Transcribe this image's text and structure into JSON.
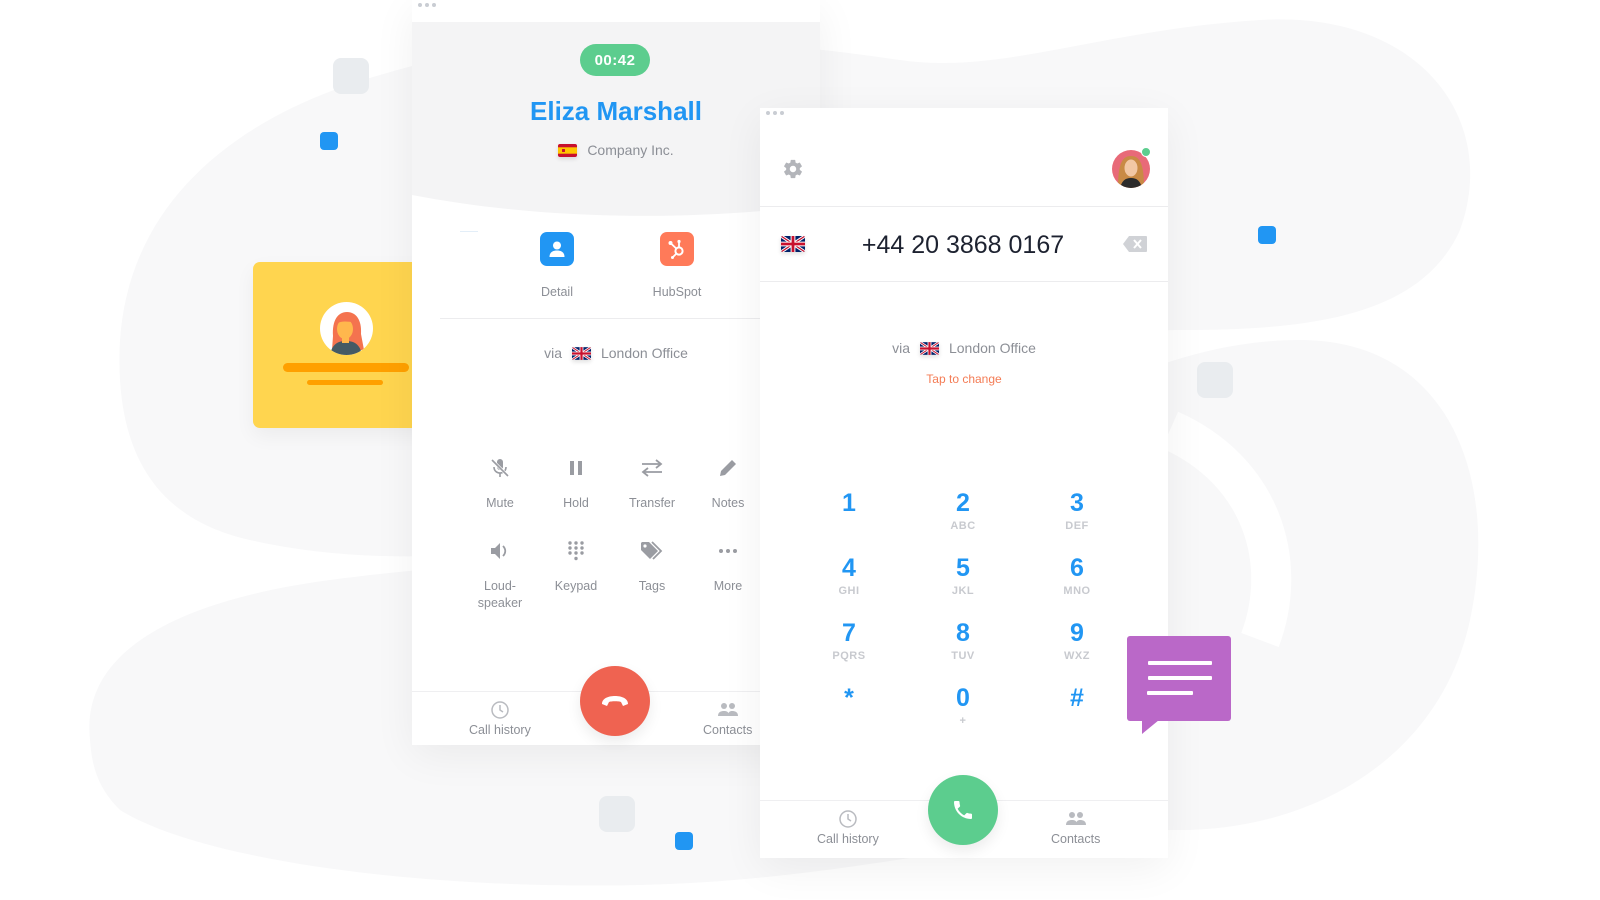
{
  "call_panel": {
    "timer": "00:42",
    "contact_name": "Eliza Marshall",
    "company": "Company Inc.",
    "company_flag": "spain-flag",
    "integrations": [
      {
        "label": "Detail",
        "icon": "contact-icon",
        "color": "#2196f3"
      },
      {
        "label": "HubSpot",
        "icon": "hubspot-icon",
        "color": "#ff7a59"
      }
    ],
    "via_prefix": "via",
    "via_line": "London Office",
    "via_flag": "uk-flag",
    "actions": [
      {
        "label": "Mute",
        "icon": "mic-off-icon"
      },
      {
        "label": "Hold",
        "icon": "pause-icon"
      },
      {
        "label": "Transfer",
        "icon": "transfer-icon"
      },
      {
        "label": "Notes",
        "icon": "pencil-icon"
      },
      {
        "label": "Loud-\nspeaker",
        "icon": "speaker-icon"
      },
      {
        "label": "Keypad",
        "icon": "keypad-icon"
      },
      {
        "label": "Tags",
        "icon": "tags-icon"
      },
      {
        "label": "More",
        "icon": "more-icon"
      }
    ],
    "nav": {
      "call_history": "Call history",
      "contacts": "Contacts"
    },
    "hangup_color": "#ef6351"
  },
  "dialer_panel": {
    "number": "+44 20 3868 0167",
    "number_flag": "uk-flag",
    "via_prefix": "via",
    "via_line": "London Office",
    "tap_to_change": "Tap to change",
    "keys": [
      {
        "digit": "1",
        "letters": ""
      },
      {
        "digit": "2",
        "letters": "ABC"
      },
      {
        "digit": "3",
        "letters": "DEF"
      },
      {
        "digit": "4",
        "letters": "GHI"
      },
      {
        "digit": "5",
        "letters": "JKL"
      },
      {
        "digit": "6",
        "letters": "MNO"
      },
      {
        "digit": "7",
        "letters": "PQRS"
      },
      {
        "digit": "8",
        "letters": "TUV"
      },
      {
        "digit": "9",
        "letters": "WXZ"
      },
      {
        "digit": "*",
        "letters": ""
      },
      {
        "digit": "0",
        "letters": "+"
      },
      {
        "digit": "#",
        "letters": ""
      }
    ],
    "nav": {
      "call_history": "Call history",
      "contacts": "Contacts"
    },
    "call_color": "#5ccd8e",
    "presence": "online"
  },
  "colors": {
    "accent_blue": "#2196f3",
    "timer_green": "#5ccd8e",
    "hangup_red": "#ef6351",
    "tap_orange": "#f47c55",
    "card_yellow": "#ffd54f",
    "chat_purple": "#ba68c8"
  }
}
